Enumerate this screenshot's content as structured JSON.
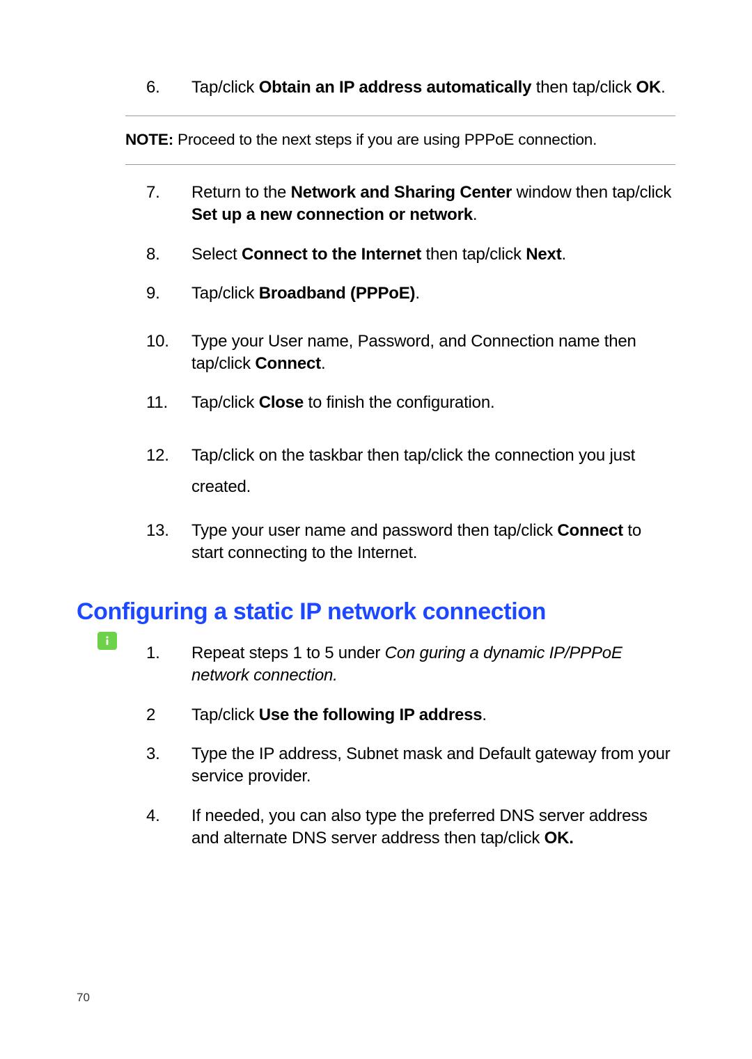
{
  "page_number": "70",
  "section1": {
    "items": [
      {
        "num": "6.",
        "segments": [
          {
            "t": "Tap/click ",
            "b": false
          },
          {
            "t": "Obtain an IP address automatically",
            "b": true
          },
          {
            "t": " then tap/click ",
            "b": false
          },
          {
            "t": "OK",
            "b": true
          },
          {
            "t": ".",
            "b": false
          }
        ]
      }
    ]
  },
  "note": {
    "label": "NOTE:",
    "text": " Proceed to the next steps if you are using PPPoE connection."
  },
  "section2": {
    "items": [
      {
        "num": "7.",
        "segments": [
          {
            "t": "Return to the ",
            "b": false
          },
          {
            "t": "Network and Sharing Center",
            "b": true
          },
          {
            "t": " window then tap/click ",
            "b": false
          },
          {
            "t": "Set up a new connection or network",
            "b": true
          },
          {
            "t": ".",
            "b": false
          }
        ]
      },
      {
        "num": "8.",
        "segments": [
          {
            "t": "Select ",
            "b": false
          },
          {
            "t": "Connect to the Internet",
            "b": true
          },
          {
            "t": " then tap/click ",
            "b": false
          },
          {
            "t": "Next",
            "b": true
          },
          {
            "t": ".",
            "b": false
          }
        ]
      },
      {
        "num": "9.",
        "segments": [
          {
            "t": "Tap/click ",
            "b": false
          },
          {
            "t": "Broadband (PPPoE)",
            "b": true
          },
          {
            "t": ".",
            "b": false
          }
        ]
      },
      {
        "num": "10.",
        "segments": [
          {
            "t": "Type your User name, Password, and Connection name then tap/click ",
            "b": false
          },
          {
            "t": "Connect",
            "b": true
          },
          {
            "t": ".",
            "b": false
          }
        ]
      },
      {
        "num": "11.",
        "segments": [
          {
            "t": "Tap/click ",
            "b": false
          },
          {
            "t": "Close",
            "b": true
          },
          {
            "t": " to finish the configuration.",
            "b": false
          }
        ]
      },
      {
        "num": "12.",
        "segments": [
          {
            "t": "Tap/click            on the taskbar then tap/click the connection you just created.",
            "b": false
          }
        ]
      },
      {
        "num": "13.",
        "segments": [
          {
            "t": "Type your user name and password then tap/click ",
            "b": false
          },
          {
            "t": "Connect",
            "b": true
          },
          {
            "t": " to start connecting to the Internet.",
            "b": false
          }
        ]
      }
    ]
  },
  "heading": "Configuring a static IP network connection",
  "section3": {
    "items": [
      {
        "num": "1.",
        "segments": [
          {
            "t": "Repeat steps 1 to 5 under ",
            "b": false
          },
          {
            "t": "Con guring a dynamic IP/PPPoE network connection.",
            "b": false,
            "i": true
          }
        ]
      },
      {
        "num": "2",
        "segments": [
          {
            "t": "Tap/click ",
            "b": false
          },
          {
            "t": "Use the following IP address",
            "b": true
          },
          {
            "t": ".",
            "b": false
          }
        ]
      },
      {
        "num": "3.",
        "segments": [
          {
            "t": "Type the IP address, Subnet mask and Default gateway from your service provider.",
            "b": false
          }
        ]
      },
      {
        "num": "4.",
        "segments": [
          {
            "t": "If needed, you can also type the preferred DNS server address and alternate DNS server address then tap/click ",
            "b": false
          },
          {
            "t": "OK.",
            "b": true
          }
        ]
      }
    ]
  }
}
